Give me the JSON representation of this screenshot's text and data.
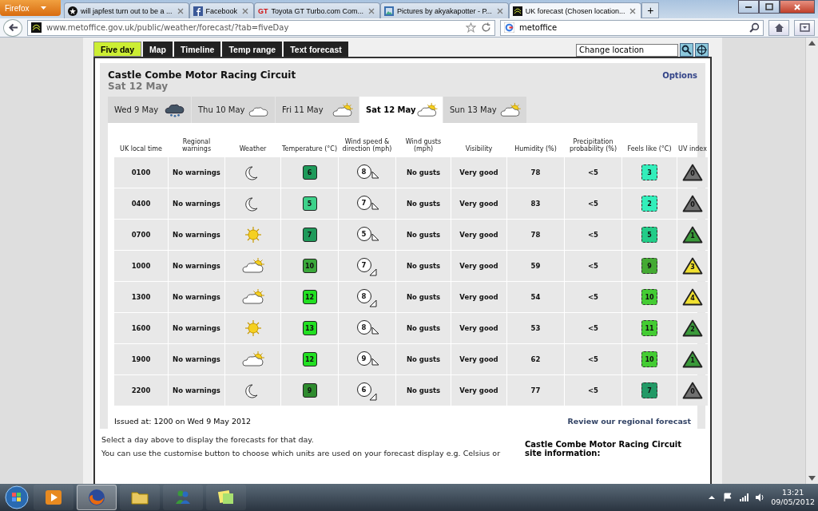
{
  "browser": {
    "menu_button": "Firefox",
    "tabs": [
      {
        "title": "will japfest turn out to be a ...",
        "selected": false
      },
      {
        "title": "Facebook",
        "selected": false
      },
      {
        "title": "Toyota GT Turbo.com Com...",
        "icon_text": "GT",
        "selected": false
      },
      {
        "title": "Pictures by akyakapotter - P...",
        "selected": false
      },
      {
        "title": "UK forecast (Chosen location...",
        "selected": true
      }
    ],
    "new_tab": "+",
    "address": "www.metoffice.gov.uk/public/weather/forecast/?tab=fiveDay",
    "search": "metoffice"
  },
  "site_tabs": [
    {
      "label": "Five day",
      "selected": true
    },
    {
      "label": "Map",
      "selected": false
    },
    {
      "label": "Timeline",
      "selected": false
    },
    {
      "label": "Temp range",
      "selected": false
    },
    {
      "label": "Text forecast",
      "selected": false
    }
  ],
  "location_field": {
    "value": "Change location"
  },
  "location": {
    "name": "Castle Combe Motor Racing Circuit",
    "date": "Sat 12 May",
    "options": "Options"
  },
  "day_tabs": [
    {
      "label": "Wed 9 May",
      "kind": "rain_cloud",
      "selected": false
    },
    {
      "label": "Thu 10 May",
      "kind": "cloud",
      "selected": false
    },
    {
      "label": "Fri 11 May",
      "kind": "sun_cloud",
      "selected": false
    },
    {
      "label": "Sat 12 May",
      "kind": "sun_cloud",
      "selected": true
    },
    {
      "label": "Sun 13 May",
      "kind": "sun_cloud",
      "selected": false
    }
  ],
  "table": {
    "columns": [
      "UK local time",
      "Regional warnings",
      "Weather",
      "Temperature (°C)",
      "Wind speed & direction (mph)",
      "Wind gusts (mph)",
      "Visibility",
      "Humidity (%)",
      "Precipitation probability (%)",
      "Feels like (°C)",
      "UV index"
    ],
    "rows": [
      {
        "time": "0100",
        "warnings": "No warnings",
        "weather": {
          "kind": "moon"
        },
        "temperature": {
          "value": "6",
          "color": "#1e9a5a"
        },
        "wind": {
          "speed": "8",
          "kind": "e"
        },
        "gusts": "No gusts",
        "visibility": "Very good",
        "humidity": "78",
        "precipitation": "<5",
        "feels_like": {
          "value": "3",
          "color": "#33eebb"
        },
        "uv": {
          "value": "0",
          "color": "#707070"
        }
      },
      {
        "time": "0400",
        "warnings": "No warnings",
        "weather": {
          "kind": "moon"
        },
        "temperature": {
          "value": "5",
          "color": "#3dd18a"
        },
        "wind": {
          "speed": "7",
          "kind": "e"
        },
        "gusts": "No gusts",
        "visibility": "Very good",
        "humidity": "83",
        "precipitation": "<5",
        "feels_like": {
          "value": "2",
          "color": "#33eebb"
        },
        "uv": {
          "value": "0",
          "color": "#707070"
        }
      },
      {
        "time": "0700",
        "warnings": "No warnings",
        "weather": {
          "kind": "sun"
        },
        "temperature": {
          "value": "7",
          "color": "#1e9a5a"
        },
        "wind": {
          "speed": "5",
          "kind": "e"
        },
        "gusts": "No gusts",
        "visibility": "Very good",
        "humidity": "78",
        "precipitation": "<5",
        "feels_like": {
          "value": "5",
          "color": "#22cc88"
        },
        "uv": {
          "value": "1",
          "color": "#3a9a3a"
        }
      },
      {
        "time": "1000",
        "warnings": "No warnings",
        "weather": {
          "kind": "sun_cloud"
        },
        "temperature": {
          "value": "10",
          "color": "#3aa83a"
        },
        "wind": {
          "speed": "7",
          "kind": "se"
        },
        "gusts": "No gusts",
        "visibility": "Very good",
        "humidity": "59",
        "precipitation": "<5",
        "feels_like": {
          "value": "9",
          "color": "#44aa33"
        },
        "uv": {
          "value": "3",
          "color": "#f0e030"
        }
      },
      {
        "time": "1300",
        "warnings": "No warnings",
        "weather": {
          "kind": "sun_cloud"
        },
        "temperature": {
          "value": "12",
          "color": "#22e022"
        },
        "wind": {
          "speed": "8",
          "kind": "se"
        },
        "gusts": "No gusts",
        "visibility": "Very good",
        "humidity": "54",
        "precipitation": "<5",
        "feels_like": {
          "value": "10",
          "color": "#44cc33"
        },
        "uv": {
          "value": "4",
          "color": "#f0e030"
        }
      },
      {
        "time": "1600",
        "warnings": "No warnings",
        "weather": {
          "kind": "sun"
        },
        "temperature": {
          "value": "13",
          "color": "#22e022"
        },
        "wind": {
          "speed": "8",
          "kind": "e"
        },
        "gusts": "No gusts",
        "visibility": "Very good",
        "humidity": "53",
        "precipitation": "<5",
        "feels_like": {
          "value": "11",
          "color": "#44cc33"
        },
        "uv": {
          "value": "2",
          "color": "#3a9a3a"
        }
      },
      {
        "time": "1900",
        "warnings": "No warnings",
        "weather": {
          "kind": "sun_cloud"
        },
        "temperature": {
          "value": "12",
          "color": "#22e022"
        },
        "wind": {
          "speed": "9",
          "kind": "e"
        },
        "gusts": "No gusts",
        "visibility": "Very good",
        "humidity": "62",
        "precipitation": "<5",
        "feels_like": {
          "value": "10",
          "color": "#44cc33"
        },
        "uv": {
          "value": "1",
          "color": "#3a9a3a"
        }
      },
      {
        "time": "2200",
        "warnings": "No warnings",
        "weather": {
          "kind": "moon"
        },
        "temperature": {
          "value": "9",
          "color": "#2e8b2e"
        },
        "wind": {
          "speed": "6",
          "kind": "se"
        },
        "gusts": "No gusts",
        "visibility": "Very good",
        "humidity": "77",
        "precipitation": "<5",
        "feels_like": {
          "value": "7",
          "color": "#229966"
        },
        "uv": {
          "value": "0",
          "color": "#707070"
        }
      }
    ]
  },
  "issued": "Issued at: 1200 on Wed 9 May 2012",
  "regional_link": "Review our regional forecast",
  "notes": [
    "Select a day above to display the forecasts for that day.",
    "You can use the customise button to choose which units are used on your forecast display e.g. Celsius or"
  ],
  "site_info": {
    "title": "Castle Combe Motor Racing Circuit site information:"
  },
  "taskbar": {
    "apps": [
      {
        "active": false
      },
      {
        "active": true
      },
      {
        "active": false
      },
      {
        "active": false
      },
      {
        "active": false
      }
    ],
    "time": "13:21",
    "date": "09/05/2012"
  }
}
